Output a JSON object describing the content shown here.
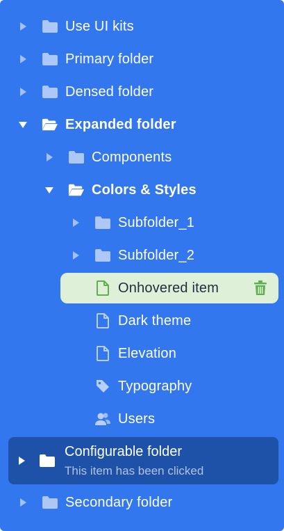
{
  "colors": {
    "panel_bg": "#3377ee",
    "hover_bg": "#dff0d8",
    "hover_accent": "#5fae4f",
    "selected_bg": "#1e52a8",
    "text": "#ffffff"
  },
  "tree": {
    "use_ui_kits": "Use UI kits",
    "primary_folder": "Primary folder",
    "densed_folder": "Densed folder",
    "expanded_folder": "Expanded folder",
    "components": "Components",
    "colors_styles": "Colors & Styles",
    "subfolder_1": "Subfolder_1",
    "subfolder_2": "Subfolder_2",
    "onhovered_item": "Onhovered item",
    "dark_theme": "Dark theme",
    "elevation": "Elevation",
    "typography": "Typography",
    "users": "Users",
    "configurable_folder": "Configurable folder",
    "configurable_sub": "This item has been clicked",
    "secondary_folder": "Secondary folder"
  },
  "icons": {
    "folder": "folder-icon",
    "folder_open": "folder-open-icon",
    "file": "file-icon",
    "tag": "tag-icon",
    "users": "users-icon",
    "trash": "trash-icon",
    "caret_right": "caret-right-icon",
    "caret_down": "caret-down-icon"
  }
}
